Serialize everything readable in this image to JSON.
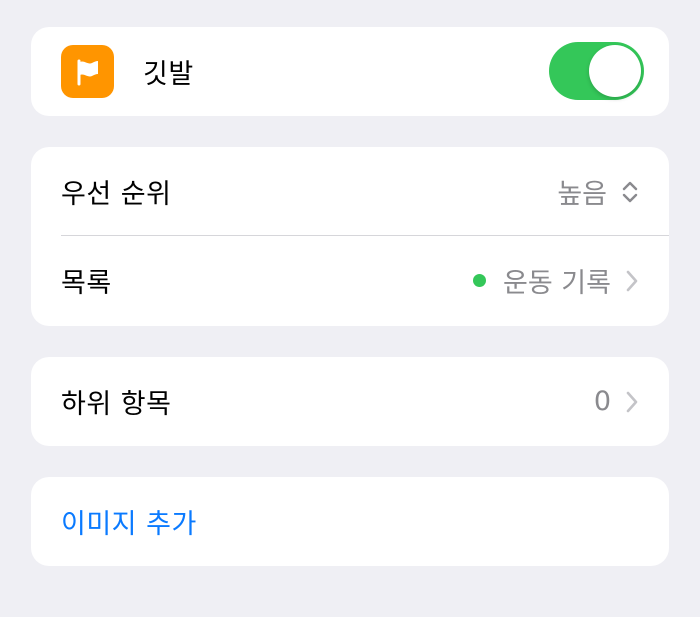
{
  "flag": {
    "label": "깃발",
    "enabled": true,
    "icon": "flag-icon",
    "icon_bg": "#ff9500",
    "toggle_color": "#34c759"
  },
  "details": {
    "priority_label": "우선 순위",
    "priority_value": "높음",
    "priority_icon": "chevron-up-down-icon",
    "list_label": "목록",
    "list_value": "운동 기록",
    "list_color": "#34c759",
    "list_icon": "chevron-right-icon"
  },
  "subtasks": {
    "label": "하위 항목",
    "count": "0",
    "icon": "chevron-right-icon"
  },
  "image": {
    "add_label": "이미지 추가",
    "link_color": "#0a7aff"
  }
}
